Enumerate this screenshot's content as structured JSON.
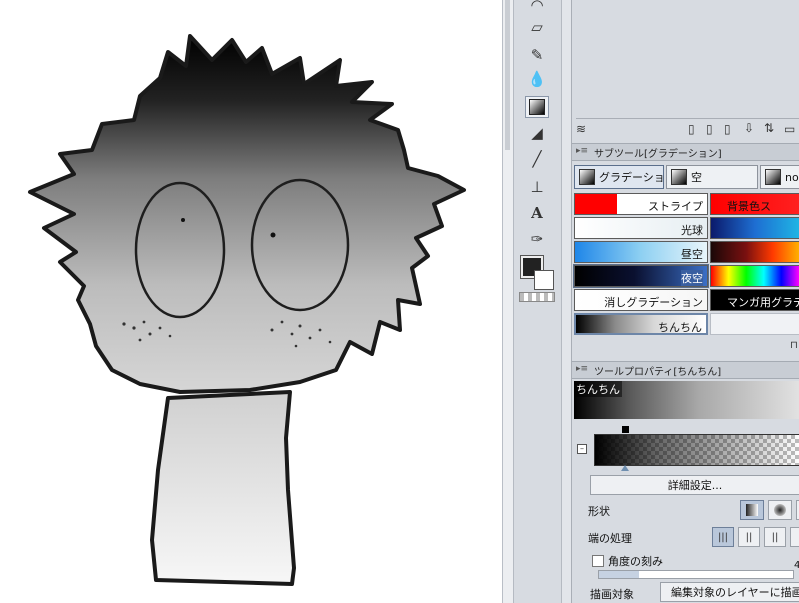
{
  "sub_tool_panel": {
    "title": "サブツール[グラデーション]",
    "tabs": [
      {
        "label": "グラデーション",
        "active": true
      },
      {
        "label": "空",
        "active": false
      },
      {
        "label": "nos",
        "active": false
      }
    ],
    "gradients_left": [
      {
        "label": "ストライプ",
        "bg": "linear-gradient(90deg,#ff0000 0%,#ff0000 32%,#ffffff 32%,#ffffff 100%)",
        "light_text": false
      },
      {
        "label": "光球",
        "bg": "linear-gradient(90deg,#ffffff 0%,#e6eef2 100%)",
        "light_text": false
      },
      {
        "label": "昼空",
        "bg": "linear-gradient(90deg,#1f86e8 0%,#8ed0f2 50%,#e8f5fb 100%)",
        "light_text": false
      },
      {
        "label": "夜空",
        "bg": "linear-gradient(90deg,#000000 0%,#0a1030 45%,#3b6fc6 100%)",
        "light_text": true
      },
      {
        "label": "消しグラデーション",
        "bg": "linear-gradient(90deg,#ffffff 0%,#f6f6f6 100%)",
        "light_text": false
      },
      {
        "label": "ちんちん",
        "bg": "linear-gradient(90deg,#000000 0%,#8a8a8a 30%,#d8d8d8 60%,#ffffff 100%)",
        "light_text": false
      }
    ],
    "gradients_right": [
      {
        "label": "背景色ス",
        "bg": "linear-gradient(90deg,#ff0000 0%,#ff2020 100%)",
        "light_text": false
      },
      {
        "label": "",
        "bg": "linear-gradient(90deg,#0b1a6b 0%,#1e6ed2 50%,#1fb4e4 100%)",
        "light_text": false
      },
      {
        "label": "",
        "bg": "linear-gradient(90deg,#1a0808 0%,#7a1010 40%,#ff3a00 70%,#ffb000 100%)",
        "light_text": false
      },
      {
        "label": "",
        "bg": "linear-gradient(90deg,#ff0000 0%,#ffff00 20%,#00ff00 40%,#00ffff 60%,#0000ff 80%,#ff00ff 100%)",
        "light_text": false
      },
      {
        "label": "マンガ用グラデ",
        "bg": "linear-gradient(90deg,#000000 0%,#000000 100%)",
        "light_text": true
      },
      {
        "label": "",
        "bg": "linear-gradient(90deg,#f0f2f5 0%,#f0f2f5 100%)",
        "light_text": false
      }
    ]
  },
  "tool_property_panel": {
    "title": "ツールプロパティ[ちんちん]",
    "preset_name": "ちんちん",
    "detail_button": "詳細設定...",
    "shape_label": "形状",
    "edge_label": "端の処理",
    "angle_step_label": "角度の刻み",
    "draw_target_label": "描画対象",
    "draw_target_value": "編集対象のレイヤーに描画",
    "angle_value": "4"
  }
}
